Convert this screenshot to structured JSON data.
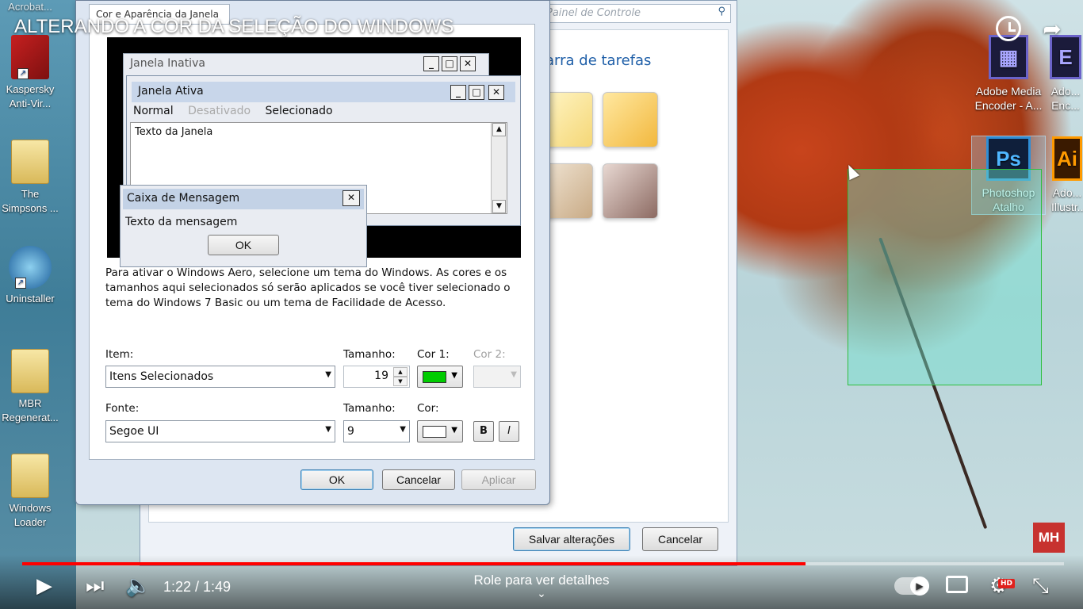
{
  "video": {
    "title": "ALTERANDO A COR DA SELEÇÃO DO WINDOWS",
    "current_time": "1:22",
    "duration": "1:49",
    "time_display": "1:22 / 1:49",
    "progress_fraction": 0.752,
    "scroll_hint": "Role para ver detalhes",
    "hd_badge": "HD",
    "brand_logo": "MH"
  },
  "desktop_left": {
    "top_label": "Acrobat...",
    "items": [
      {
        "label": "Kaspersky Anti-Vir...",
        "icon": "kaspersky-icon"
      },
      {
        "label": "The Simpsons ...",
        "icon": "folder-icon"
      },
      {
        "label": "Uninstaller",
        "icon": "uninstaller-icon"
      },
      {
        "label": "MBR Regenerat...",
        "icon": "folder-icon"
      },
      {
        "label": "Windows Loader",
        "icon": "folder-icon"
      }
    ]
  },
  "desktop_right": {
    "items": [
      {
        "label": "Adobe Media Encoder - A...",
        "icon": "adobe-media-encoder-icon"
      },
      {
        "label": "Ado... Enc...",
        "icon": "adobe-media-encoder-icon"
      },
      {
        "label": "Photoshop Atalho",
        "icon": "photoshop-icon"
      },
      {
        "label": "Ado... Illustr...",
        "icon": "illustrator-icon"
      }
    ]
  },
  "control_panel": {
    "search_placeholder": "Painel de Controle",
    "heading_partial": "arra de tarefas",
    "save_button": "Salvar alterações",
    "cancel_button": "Cancelar"
  },
  "dialog": {
    "tab_label": "Cor e Aparência da Janela",
    "preview": {
      "inactive_title": "Janela Inativa",
      "active_title": "Janela Ativa",
      "menu": {
        "normal": "Normal",
        "disabled": "Desativado",
        "selected": "Selecionado"
      },
      "window_text": "Texto da Janela",
      "message_title": "Caixa de Mensagem",
      "message_text": "Texto da mensagem",
      "ok": "OK"
    },
    "description": "Para ativar o Windows Aero, selecione um tema do Windows.  As cores e os tamanhos aqui selecionados só serão aplicados se você tiver selecionado o tema do Windows 7 Basic ou um tema de Facilidade de Acesso.",
    "item_label": "Item:",
    "item_value": "Itens Selecionados",
    "size_label": "Tamanho:",
    "size_value": "19",
    "color1_label": "Cor 1:",
    "color1_value": "#00cc00",
    "color2_label": "Cor 2:",
    "font_label": "Fonte:",
    "font_value": "Segoe UI",
    "font_size_label": "Tamanho:",
    "font_size_value": "9",
    "font_color_label": "Cor:",
    "font_color_value": "#ffffff",
    "bold": "B",
    "italic": "I",
    "ok": "OK",
    "cancel": "Cancelar",
    "apply": "Aplicar"
  }
}
